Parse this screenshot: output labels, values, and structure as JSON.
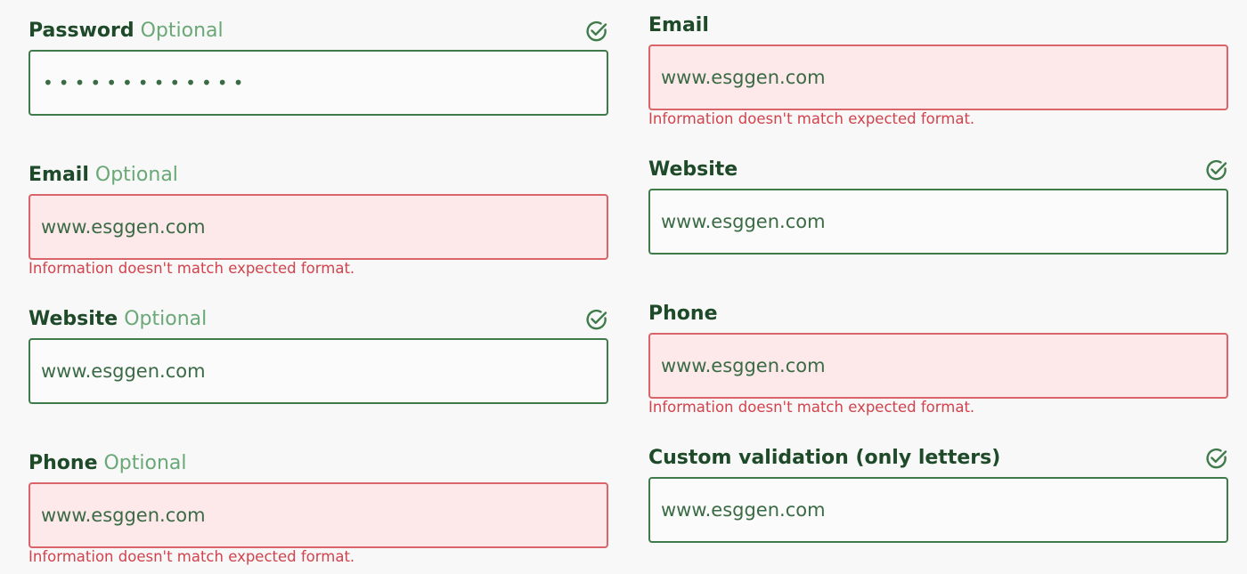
{
  "left": {
    "password": {
      "label": "Password",
      "optional": "Optional",
      "value": "•••••••••••••"
    },
    "email": {
      "label": "Email",
      "optional": "Optional",
      "value": "www.esggen.com",
      "error": "Information doesn't match expected format."
    },
    "website": {
      "label": "Website",
      "optional": "Optional",
      "value": "www.esggen.com"
    },
    "phone": {
      "label": "Phone",
      "optional": "Optional",
      "value": "www.esggen.com",
      "error": "Information doesn't match expected format."
    }
  },
  "right": {
    "email": {
      "label": "Email",
      "value": "www.esggen.com",
      "error": "Information doesn't match expected format."
    },
    "website": {
      "label": "Website",
      "value": "www.esggen.com"
    },
    "phone": {
      "label": "Phone",
      "value": "www.esggen.com",
      "error": "Information doesn't match expected format."
    },
    "custom": {
      "label": "Custom validation (only letters)",
      "value": "www.esggen.com"
    }
  },
  "icons": {
    "valid": "check-circle-icon"
  },
  "colors": {
    "valid_border": "#3f7a4a",
    "invalid_border": "#d9646a",
    "invalid_bg": "#fde8ea",
    "error_text": "#d2434d",
    "label": "#1f4a2a",
    "optional": "#6aa877"
  }
}
